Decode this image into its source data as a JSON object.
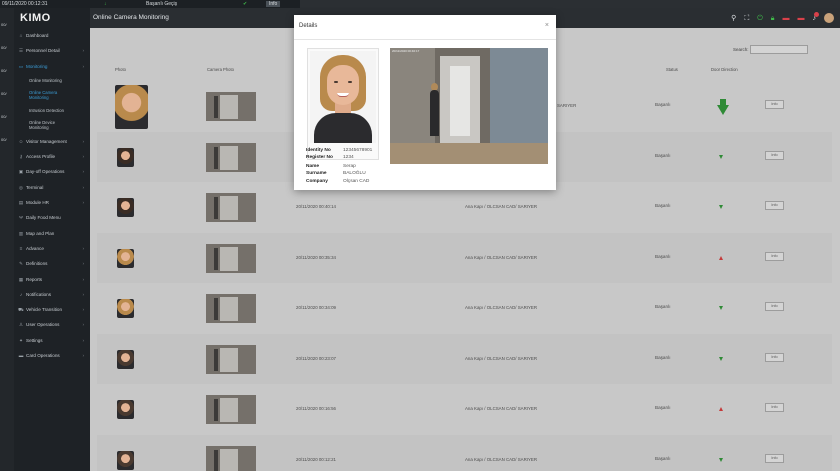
{
  "bg_panel": {
    "timestamp": "09/11/2020 00:12:31",
    "status": "Başarılı Geçiş",
    "info_label": "Info",
    "left_times": [
      "00/",
      "00/",
      "00/",
      "00/",
      "00/",
      "00/"
    ]
  },
  "app": {
    "logo": "KIMO",
    "page_title": "Online Camera Monitoring"
  },
  "sidebar": {
    "items": [
      {
        "icon": "home-icon",
        "glyph": "⌂",
        "label": "Dashboard",
        "chevron": false
      },
      {
        "icon": "users-icon",
        "glyph": "☰",
        "label": "Personnel Detail",
        "chevron": true
      },
      {
        "icon": "monitor-icon",
        "glyph": "▭",
        "label": "Monitoring",
        "chevron": true,
        "active": true
      }
    ],
    "sub_items": [
      {
        "label": "Online Monitoring",
        "selected": false,
        "two_line": false
      },
      {
        "label": "Online Camera Monitoring",
        "selected": true,
        "two_line": true
      },
      {
        "label": "Intrusion Detection",
        "selected": false,
        "two_line": false
      },
      {
        "label": "Online Device Monitoring",
        "selected": false,
        "two_line": true
      }
    ],
    "items2": [
      {
        "icon": "visitor-icon",
        "glyph": "☺",
        "label": "Visitor Management",
        "chevron": true
      },
      {
        "icon": "key-icon",
        "glyph": "⚷",
        "label": "Access Profile",
        "chevron": true
      },
      {
        "icon": "briefcase-icon",
        "glyph": "▣",
        "label": "Day-off Operations",
        "chevron": true
      },
      {
        "icon": "terminal-icon",
        "glyph": "◎",
        "label": "Terminal",
        "chevron": true
      },
      {
        "icon": "module-icon",
        "glyph": "▤",
        "label": "Module HR",
        "chevron": true
      },
      {
        "icon": "food-icon",
        "glyph": "Ψ",
        "label": "Daily Food Menu",
        "chevron": false
      },
      {
        "icon": "map-icon",
        "glyph": "▥",
        "label": "Map and Plan",
        "chevron": false
      },
      {
        "icon": "advance-icon",
        "glyph": "≡",
        "label": "Advance",
        "chevron": true
      },
      {
        "icon": "definitions-icon",
        "glyph": "✎",
        "label": "Definitions",
        "chevron": true
      },
      {
        "icon": "reports-icon",
        "glyph": "▦",
        "label": "Reports",
        "chevron": true
      },
      {
        "icon": "bell-icon",
        "glyph": "♪",
        "label": "Notifications",
        "chevron": true
      },
      {
        "icon": "vehicle-icon",
        "glyph": "⛟",
        "label": "Vehicle Transition",
        "chevron": true
      },
      {
        "icon": "user-ops-icon",
        "glyph": "♙",
        "label": "User Operations",
        "chevron": true
      },
      {
        "icon": "settings-icon",
        "glyph": "✦",
        "label": "Settings",
        "chevron": true
      },
      {
        "icon": "card-icon",
        "glyph": "▬",
        "label": "Card Operations",
        "chevron": true
      }
    ]
  },
  "topbar": {
    "icons": [
      "search-icon",
      "expand-icon",
      "power-icon",
      "lock-icon",
      "flag-icon",
      "flag-icon",
      "bell-icon",
      "avatar"
    ]
  },
  "table": {
    "search_label": "Search:",
    "headers": {
      "photo": "Photo",
      "camera": "Camera Photo",
      "status": "Status",
      "direction": "Door Direction"
    },
    "status": "Başarılı",
    "info_label": "Info",
    "rows": [
      {
        "time": "",
        "door": "SARIYER",
        "dir": "down",
        "face": "woman-blond"
      },
      {
        "time": "",
        "door": "",
        "dir": "down",
        "face": "man-dark"
      },
      {
        "time": "20/11/2020 00:40:14",
        "door": "Ana Kapı / OLCSAN CAD/ SARIYER",
        "dir": "down",
        "face": "man-dark"
      },
      {
        "time": "20/11/2020 00:35:34",
        "door": "Ana Kapı / OLCSAN CAD/ SARIYER",
        "dir": "up",
        "face": "woman-blond"
      },
      {
        "time": "20/11/2020 00:34:09",
        "door": "Ana Kapı / OLCSAN CAD/ SARIYER",
        "dir": "down",
        "face": "woman-blond"
      },
      {
        "time": "20/11/2020 00:23:07",
        "door": "Ana Kapı / OLCSAN CAD/ SARIYER",
        "dir": "down",
        "face": "man-light"
      },
      {
        "time": "20/11/2020 00:16:56",
        "door": "Ana Kapı / OLCSAN CAD/ SARIYER",
        "dir": "up",
        "face": "man-light"
      },
      {
        "time": "20/11/2020 00:12:21",
        "door": "Ana Kapı / OLCSAN CAD/ SARIYER",
        "dir": "down",
        "face": "man-light"
      }
    ]
  },
  "modal": {
    "title": "Details",
    "close": "×",
    "camera_stamp": "20/11/2020 00:40:17",
    "fields": [
      {
        "label": "Identity No",
        "value": "12345678901"
      },
      {
        "label": "Register No",
        "value": "1234"
      },
      {
        "label": "Name",
        "value": "Serap"
      },
      {
        "label": "Surname",
        "value": "BALOĞLU"
      },
      {
        "label": "Company",
        "value": "Olçsan CAD"
      }
    ]
  },
  "colors": {
    "accent": "#3b9ed8",
    "success": "#2f8a36",
    "danger": "#c43a3a"
  }
}
